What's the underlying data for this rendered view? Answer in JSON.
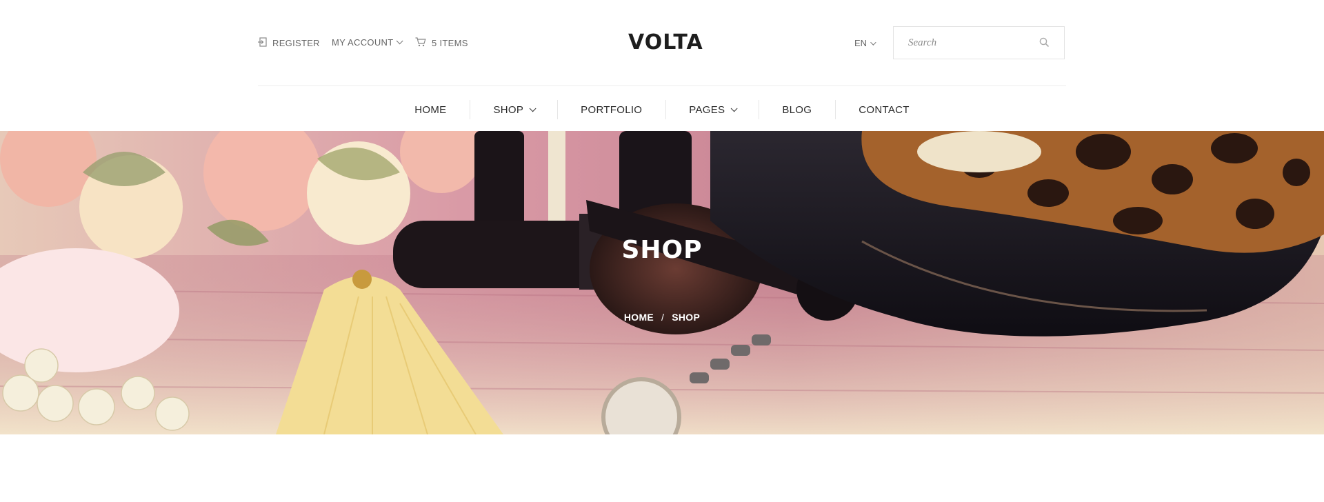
{
  "header": {
    "register_label": "REGISTER",
    "account_label": "MY ACCOUNT",
    "cart_label": "5 ITEMS",
    "logo": "VOLTA",
    "language": "EN",
    "search_placeholder": "Search"
  },
  "nav": {
    "items": [
      {
        "label": "HOME",
        "has_dropdown": false
      },
      {
        "label": "SHOP",
        "has_dropdown": true
      },
      {
        "label": "PORTFOLIO",
        "has_dropdown": false
      },
      {
        "label": "PAGES",
        "has_dropdown": true
      },
      {
        "label": "BLOG",
        "has_dropdown": false
      },
      {
        "label": "CONTACT",
        "has_dropdown": false
      }
    ]
  },
  "hero": {
    "title": "SHOP",
    "breadcrumb": {
      "home": "HOME",
      "separator": "/",
      "current": "SHOP"
    }
  },
  "icons": {
    "register": "login-icon",
    "cart": "cart-icon",
    "search": "search-icon"
  },
  "colors": {
    "text_dark": "#1e1e1e",
    "text_muted": "#666666",
    "hero_text": "#ffffff"
  }
}
